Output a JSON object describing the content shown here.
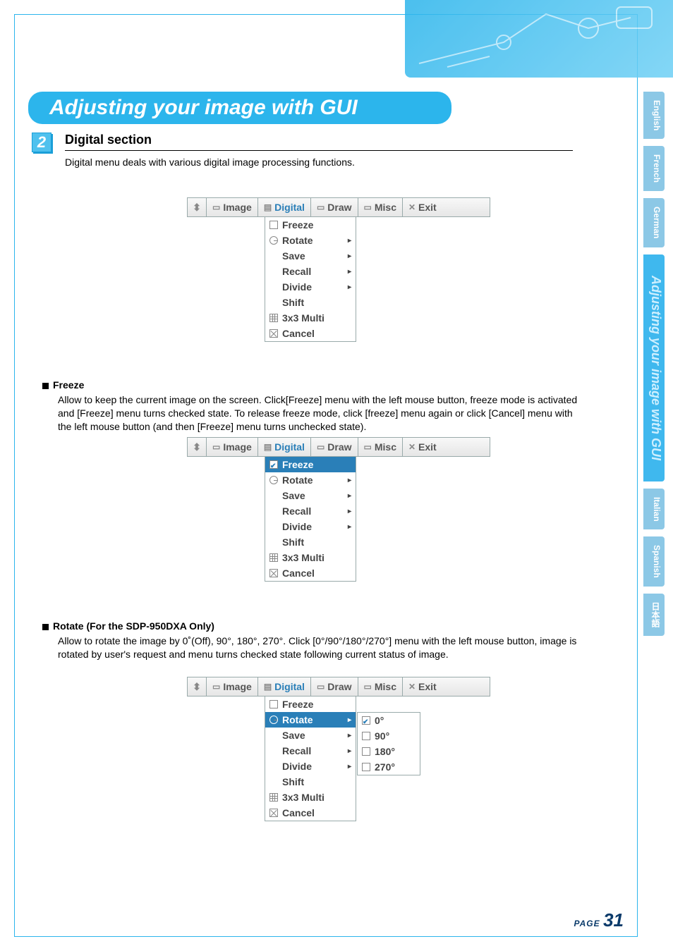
{
  "title": "Adjusting your image with GUI",
  "section": {
    "number": "2",
    "heading": "Digital section",
    "description": "Digital menu deals with various digital image processing functions."
  },
  "menubar": {
    "tabs": [
      "Image",
      "Digital",
      "Draw",
      "Misc",
      "Exit"
    ],
    "active_index": 1
  },
  "digital_menu": {
    "items": [
      {
        "icon": "checkbox",
        "label": "Freeze",
        "checked": false,
        "has_sub": false
      },
      {
        "icon": "rotate",
        "label": "Rotate",
        "has_sub": true
      },
      {
        "icon": "none",
        "label": "Save",
        "has_sub": true
      },
      {
        "icon": "none",
        "label": "Recall",
        "has_sub": true
      },
      {
        "icon": "none",
        "label": "Divide",
        "has_sub": true
      },
      {
        "icon": "none",
        "label": "Shift",
        "has_sub": false
      },
      {
        "icon": "grid",
        "label": "3x3 Multi",
        "has_sub": false
      },
      {
        "icon": "close",
        "label": "Cancel",
        "has_sub": false
      }
    ]
  },
  "freeze_block": {
    "heading": "Freeze",
    "body": "Allow to keep the current image on the screen. Click[Freeze] menu with the left mouse button, freeze mode is activated and [Freeze] menu turns checked state. To release freeze mode, click [freeze] menu again or click [Cancel] menu with the left mouse button (and then [Freeze] menu turns unchecked state)."
  },
  "rotate_block": {
    "heading": "Rotate (For the SDP-950DXA Only)",
    "body": "Allow to rotate the image by 0˚(Off), 90°, 180°, 270°. Click [0°/90°/180°/270°] menu with the left mouse button, image is rotated by user's request and menu turns checked state following current status of image."
  },
  "rotate_submenu": {
    "options": [
      {
        "label": "0°",
        "checked": true
      },
      {
        "label": "90°",
        "checked": false
      },
      {
        "label": "180°",
        "checked": false
      },
      {
        "label": "270°",
        "checked": false
      }
    ]
  },
  "side_tabs": [
    "English",
    "French",
    "German",
    "Adjusting your image with GUI",
    "Italian",
    "Spanish",
    "日本語"
  ],
  "side_tall_index": 3,
  "page": {
    "label": "PAGE",
    "number": "31"
  }
}
